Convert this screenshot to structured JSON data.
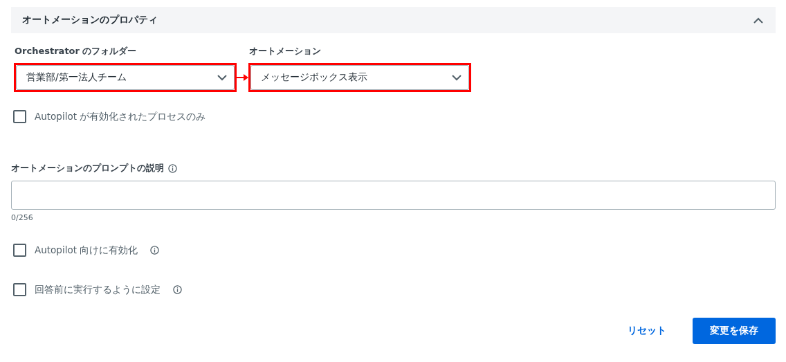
{
  "section": {
    "title": "オートメーションのプロパティ",
    "expanded": true
  },
  "selects": [
    {
      "label": "Orchestrator のフォルダー",
      "value": "営業部/第一法人チーム",
      "highlighted": true
    },
    {
      "label": "オートメーション",
      "value": "メッセージボックス表示",
      "highlighted": true
    }
  ],
  "connector_arrow": true,
  "filter_checkbox": {
    "label": "Autopilot が有効化されたプロセスのみ",
    "checked": false
  },
  "prompt": {
    "label": "オートメーションのプロンプトの説明",
    "counter": "0/256"
  },
  "options": [
    {
      "label": "Autopilot 向けに有効化",
      "checked": false
    },
    {
      "label": "回答前に実行するように設定",
      "checked": false
    }
  ],
  "buttons": {
    "reset": "リセット",
    "save": "変更を保存"
  }
}
